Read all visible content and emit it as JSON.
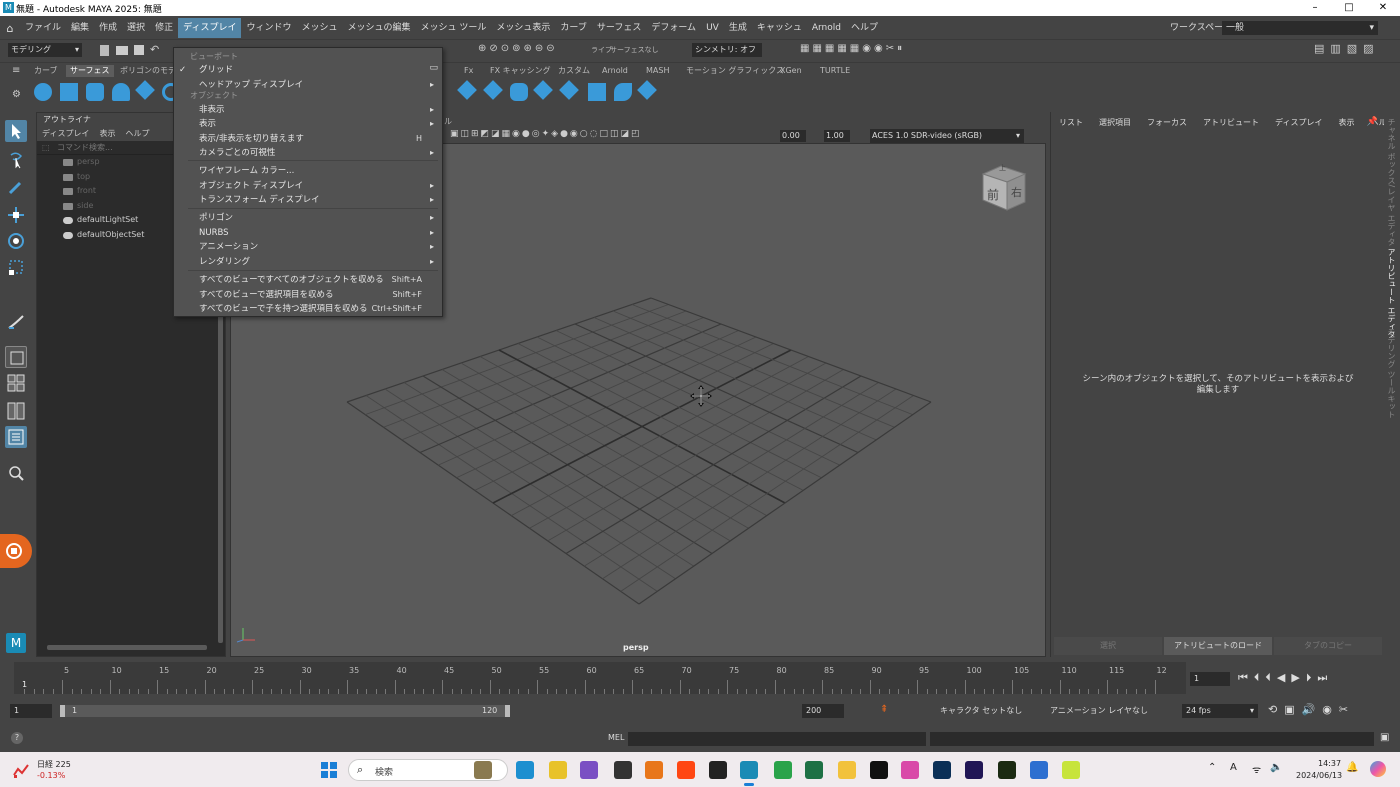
{
  "window": {
    "title": "無題 - Autodesk MAYA 2025: 無題",
    "min": "–",
    "max": "□",
    "close": "✕"
  },
  "menubar": {
    "items": [
      "ファイル",
      "編集",
      "作成",
      "選択",
      "修正",
      "ディスプレイ",
      "ウィンドウ",
      "メッシュ",
      "メッシュの編集",
      "メッシュ ツール",
      "メッシュ表示",
      "カーブ",
      "サーフェス",
      "デフォーム",
      "UV",
      "生成",
      "キャッシュ",
      "Arnold",
      "ヘルプ"
    ],
    "active_index": 5,
    "workspace_label": "ワークスペース :",
    "workspace_value": "一般"
  },
  "statusline": {
    "mode": "モデリング",
    "live_label": "ライブ",
    "live_value": "サーフェスなし",
    "symmetry": "シンメトリ: オフ"
  },
  "shelf": {
    "tabs": [
      "カーブ",
      "サーフェス",
      "ポリゴンのモデ",
      "Fx",
      "FX キャッシング",
      "カスタム",
      "Arnold",
      "MASH",
      "モーション グラフィックス",
      "XGen",
      "TURTLE"
    ],
    "selected_index": 1
  },
  "outliner": {
    "title": "アウトライナ",
    "menus": [
      "ディスプレイ",
      "表示",
      "ヘルプ"
    ],
    "search_placeholder": "コマンド検索...",
    "rows": [
      {
        "label": "persp",
        "dim": true
      },
      {
        "label": "top",
        "dim": true
      },
      {
        "label": "front",
        "dim": true
      },
      {
        "label": "side",
        "dim": true
      },
      {
        "label": "defaultLightSet",
        "dim": false
      },
      {
        "label": "defaultObjectSet",
        "dim": false
      }
    ]
  },
  "viewport": {
    "panel_label": "ル",
    "exposure": "0.00",
    "gamma": "1.00",
    "color_space": "ACES 1.0 SDR-video (sRGB)",
    "camera_label": "persp",
    "cube_front": "前",
    "cube_right": "右",
    "cube_top": "上"
  },
  "attribute_editor": {
    "tabs": [
      "リスト",
      "選択項目",
      "フォーカス",
      "アトリビュート",
      "ディスプレイ",
      "表示",
      "ヘルプ"
    ],
    "message": "シーン内のオブジェクトを選択して、そのアトリビュートを表示および編集します",
    "buttons": [
      "選択",
      "アトリビュートのロード",
      "タブのコピー"
    ]
  },
  "side_tabs": [
    "チャネル ボックス/レイヤ エディタ",
    "アトリビュート エディタ",
    "モデリング ツールキット"
  ],
  "dropdown": {
    "sections": [
      "ビューポート",
      "オブジェクト"
    ],
    "items": [
      {
        "label": "グリッド",
        "shortcut": "",
        "arrow": "",
        "checked": true
      },
      {
        "label": "ヘッドアップ ディスプレイ",
        "shortcut": "",
        "arrow": "▸"
      },
      {
        "label": "非表示",
        "shortcut": "",
        "arrow": "▸"
      },
      {
        "label": "表示",
        "shortcut": "",
        "arrow": "▸"
      },
      {
        "label": "表示/非表示を切り替えます",
        "shortcut": "H",
        "arrow": ""
      },
      {
        "label": "カメラごとの可視性",
        "shortcut": "",
        "arrow": "▸"
      },
      {
        "label": "ワイヤフレーム カラー...",
        "shortcut": "",
        "arrow": ""
      },
      {
        "label": "オブジェクト ディスプレイ",
        "shortcut": "",
        "arrow": "▸"
      },
      {
        "label": "トランスフォーム ディスプレイ",
        "shortcut": "",
        "arrow": "▸"
      },
      {
        "label": "ポリゴン",
        "shortcut": "",
        "arrow": "▸"
      },
      {
        "label": "NURBS",
        "shortcut": "",
        "arrow": "▸"
      },
      {
        "label": "アニメーション",
        "shortcut": "",
        "arrow": "▸"
      },
      {
        "label": "レンダリング",
        "shortcut": "",
        "arrow": "▸"
      },
      {
        "label": "すべてのビューですべてのオブジェクトを収める",
        "shortcut": "Shift+A",
        "arrow": ""
      },
      {
        "label": "すべてのビューで選択項目を収める",
        "shortcut": "Shift+F",
        "arrow": ""
      },
      {
        "label": "すべてのビューで子を持つ選択項目を収める",
        "shortcut": "Ctrl+Shift+F",
        "arrow": ""
      }
    ]
  },
  "timeline": {
    "ticks": [
      "5",
      "10",
      "15",
      "20",
      "25",
      "30",
      "35",
      "40",
      "45",
      "50",
      "55",
      "60",
      "65",
      "70",
      "75",
      "80",
      "85",
      "90",
      "95",
      "100",
      "105",
      "110",
      "115",
      "12"
    ],
    "start_marker": "1",
    "current_frame": "1"
  },
  "range": {
    "start": "1",
    "inner_start": "1",
    "inner_end": "120",
    "end": "200",
    "character_set": "キャラクタ セットなし",
    "anim_layer": "アニメーション レイヤなし",
    "fps": "24 fps"
  },
  "cmdline": {
    "label": "MEL",
    "help": "?"
  },
  "taskbar": {
    "stock_name": "日経 225",
    "stock_change": "-0.13%",
    "search_placeholder": "検索",
    "time": "14:37",
    "date": "2024/06/13",
    "lang_indicator": "A"
  }
}
